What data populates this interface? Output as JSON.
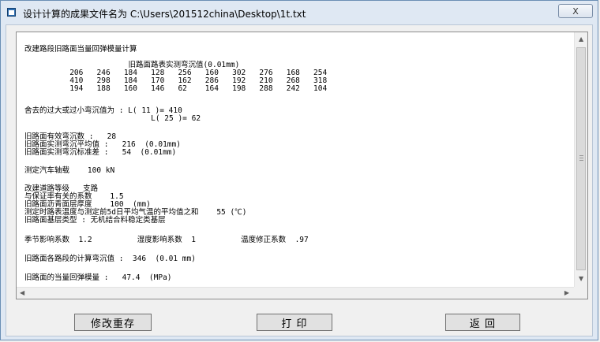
{
  "window": {
    "title": "设计计算的成果文件名为 C:\\Users\\201512china\\Desktop\\1t.txt",
    "close_label": "X"
  },
  "report": {
    "lines": [
      {
        "text": "改建路段旧路面当量回弹模量计算"
      },
      {
        "text": "                       旧路面路表实测弯沉值(0.01mm)"
      },
      {
        "text": "          206   246   184   128   256   160   302   276   168   254"
      },
      {
        "text": "          410   298   184   170   162   286   192   210   268   318"
      },
      {
        "text": "          194   188   160   146   62    164   198   288   242   104"
      },
      {
        "text": "舍去的过大或过小弯沉值为 : L( 11 )= 410"
      },
      {
        "text": "                            L( 25 )= 62"
      },
      {
        "text": "旧路面有效弯沉数 :   28"
      },
      {
        "text": "旧路面实测弯沉平均值 :   216  (0.01mm)"
      },
      {
        "text": "旧路面实测弯沉标准差 :   54  (0.01mm)"
      },
      {
        "text": "测定汽车轴载    100 kN"
      },
      {
        "text": "改建道路等级   支路"
      },
      {
        "text": "与保证率有关的系数    1.5"
      },
      {
        "text": "旧路面沥青面层厚度    100  (mm)"
      },
      {
        "text": "测定时路表温度与测定前5d日平均气温的平均值之和    55 (℃)"
      },
      {
        "text": "旧路面基层类型 : 无机结合料稳定类基层"
      },
      {
        "text": "季节影响系数  1.2          湿度影响系数  1          温度修正系数  .97"
      },
      {
        "text": "旧路面各路段的计算弯沉值 :  346  (0.01 mm)"
      },
      {
        "text": "旧路面的当量回弹模量 :   47.4  (MPa)"
      }
    ]
  },
  "buttons": {
    "modify": "修改重存",
    "print": "打   印",
    "back": "返   回"
  }
}
